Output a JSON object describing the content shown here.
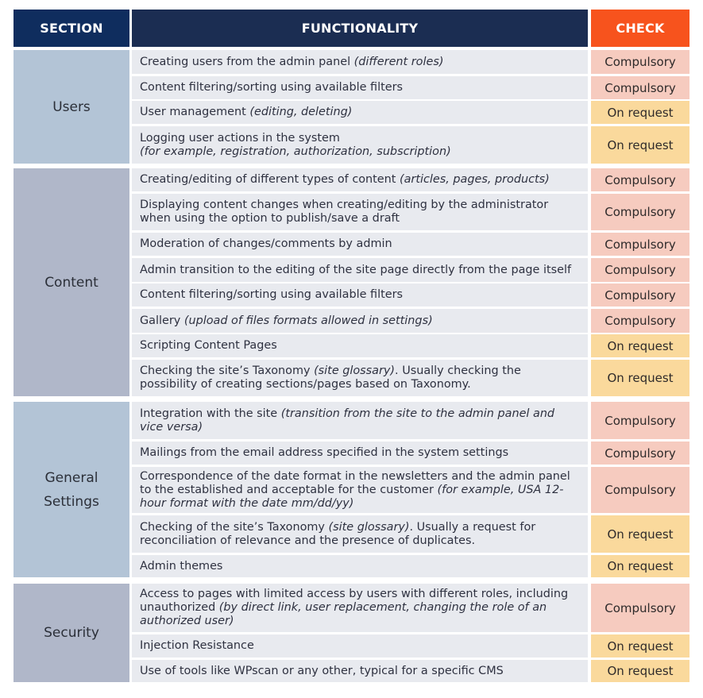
{
  "header": {
    "section": "SECTION",
    "functionality": "FUNCTIONALITY",
    "check": "CHECK"
  },
  "colors": {
    "section_header": "#0f2d5e",
    "functionality_header": "#1b2d52",
    "check_header": "#f7531d",
    "compulsory": "#f6cbbf",
    "on_request": "#fad99c",
    "row_bg": "#e8eaef",
    "users_bg": "#b3c4d6",
    "content_bg": "#b0b7c9",
    "general_settings_bg": "#b3c4d6",
    "security_bg": "#b0b7c9"
  },
  "groups": [
    {
      "section": "Users",
      "rows": [
        {
          "text": "Creating users from the admin panel ",
          "italic": "(different roles)",
          "check": "Compulsory"
        },
        {
          "text": "Content filtering/sorting using available filters",
          "italic": "",
          "check": "Compulsory"
        },
        {
          "text": "User management ",
          "italic": "(editing, deleting)",
          "check": "On request"
        },
        {
          "text": "Logging user actions in the system",
          "italic": "(for example, registration, authorization, subscription)",
          "check": "On request"
        }
      ]
    },
    {
      "section": "Content",
      "rows": [
        {
          "text": "Creating/editing of different types of content ",
          "italic": "(articles, pages, products)",
          "check": "Compulsory"
        },
        {
          "text": "Displaying content changes when creating/editing by the administrator when using the option to publish/save a draft",
          "italic": "",
          "check": "Compulsory"
        },
        {
          "text": "Moderation of changes/comments by admin",
          "italic": "",
          "check": "Compulsory"
        },
        {
          "text": "Admin transition to the editing of the site page directly from the page itself",
          "italic": "",
          "check": "Compulsory"
        },
        {
          "text": "Content filtering/sorting using available filters",
          "italic": "",
          "check": "Compulsory"
        },
        {
          "text": "Gallery ",
          "italic": "(upload of files formats allowed in settings)",
          "check": "Compulsory"
        },
        {
          "text": "Scripting Content Pages",
          "italic": "",
          "check": "On request"
        },
        {
          "text": "Checking the site’s Taxonomy ",
          "italic": "(site glossary)",
          "after": ". Usually checking the possibility of creating sections/pages based on Taxonomy.",
          "check": "On request"
        }
      ]
    },
    {
      "section": "General Settings",
      "rows": [
        {
          "text": "Integration with the site ",
          "italic": "(transition from the site to the admin panel and vice versa)",
          "check": "Compulsory"
        },
        {
          "text": "Mailings from the email address specified in the system settings",
          "italic": "",
          "check": "Compulsory"
        },
        {
          "text": "Correspondence of the date format in the newsletters and the admin panel to the established and acceptable for the customer ",
          "italic": "(for example, USA 12-hour format with the date mm/dd/yy)",
          "check": "Compulsory"
        },
        {
          "text": "Checking of the site’s Taxonomy ",
          "italic": "(site glossary)",
          "after": ".  Usually a request for reconciliation of relevance and the presence of duplicates.",
          "check": "On request"
        },
        {
          "text": "Admin themes",
          "italic": "",
          "check": "On request"
        }
      ]
    },
    {
      "section": "Security",
      "rows": [
        {
          "text": "Access to pages with limited access by users with different roles, including unauthorized ",
          "italic": "(by direct link, user replacement, changing the role of an authorized user)",
          "check": "Compulsory"
        },
        {
          "text": "Injection Resistance",
          "italic": "",
          "check": "On request"
        },
        {
          "text": "Use of tools like WPscan or any other, typical for a specific CMS",
          "italic": "",
          "check": "On request"
        }
      ]
    }
  ]
}
